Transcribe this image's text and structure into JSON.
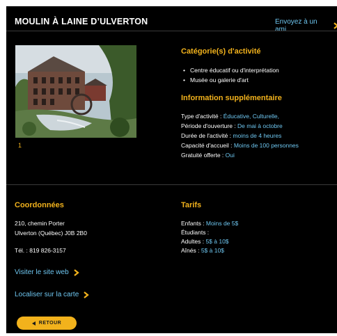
{
  "header": {
    "title": "MOULIN À LAINE D’ULVERTON",
    "send_link": "Envoyez à un ami"
  },
  "photo": {
    "counter": "1"
  },
  "categories": {
    "title": "Catégorie(s) d'activité",
    "items": [
      "Centre éducatif ou d'interprétation",
      "Musée ou galerie d'art"
    ]
  },
  "info": {
    "title": "Information supplémentaire",
    "rows": [
      {
        "label": "Type d'activité : ",
        "value": "Éducative, Culturelle,"
      },
      {
        "label": "Période d'ouverture : ",
        "value": "De mai à octobre"
      },
      {
        "label": "Durée de l'activité : ",
        "value": "moins de 4 heures"
      },
      {
        "label": "Capacité d'accueil : ",
        "value": "Moins de 100 personnes"
      },
      {
        "label": "Gratuité offerte : ",
        "value": "Oui"
      }
    ]
  },
  "contact": {
    "title": "Coordonnées",
    "address_line1": "210, chemin Porter",
    "address_line2": "Ulverton  (Québec)  J0B 2B0",
    "phone": "Tél. : 819 826-3157",
    "website_link": "Visiter le site web",
    "map_link": "Localiser sur la carte"
  },
  "tarifs": {
    "title": "Tarifs",
    "rows": [
      {
        "label": "Enfants : ",
        "value": "Moins de 5$"
      },
      {
        "label": "Étudiants : ",
        "value": ""
      },
      {
        "label": "Adultes : ",
        "value": "5$ à 10$"
      },
      {
        "label": "Aînés : ",
        "value": "5$ à 10$"
      }
    ]
  },
  "back_button": {
    "label": "RETOUR"
  },
  "colors": {
    "accent": "#f2b21c",
    "link": "#6ec6f0",
    "background": "#000000"
  }
}
